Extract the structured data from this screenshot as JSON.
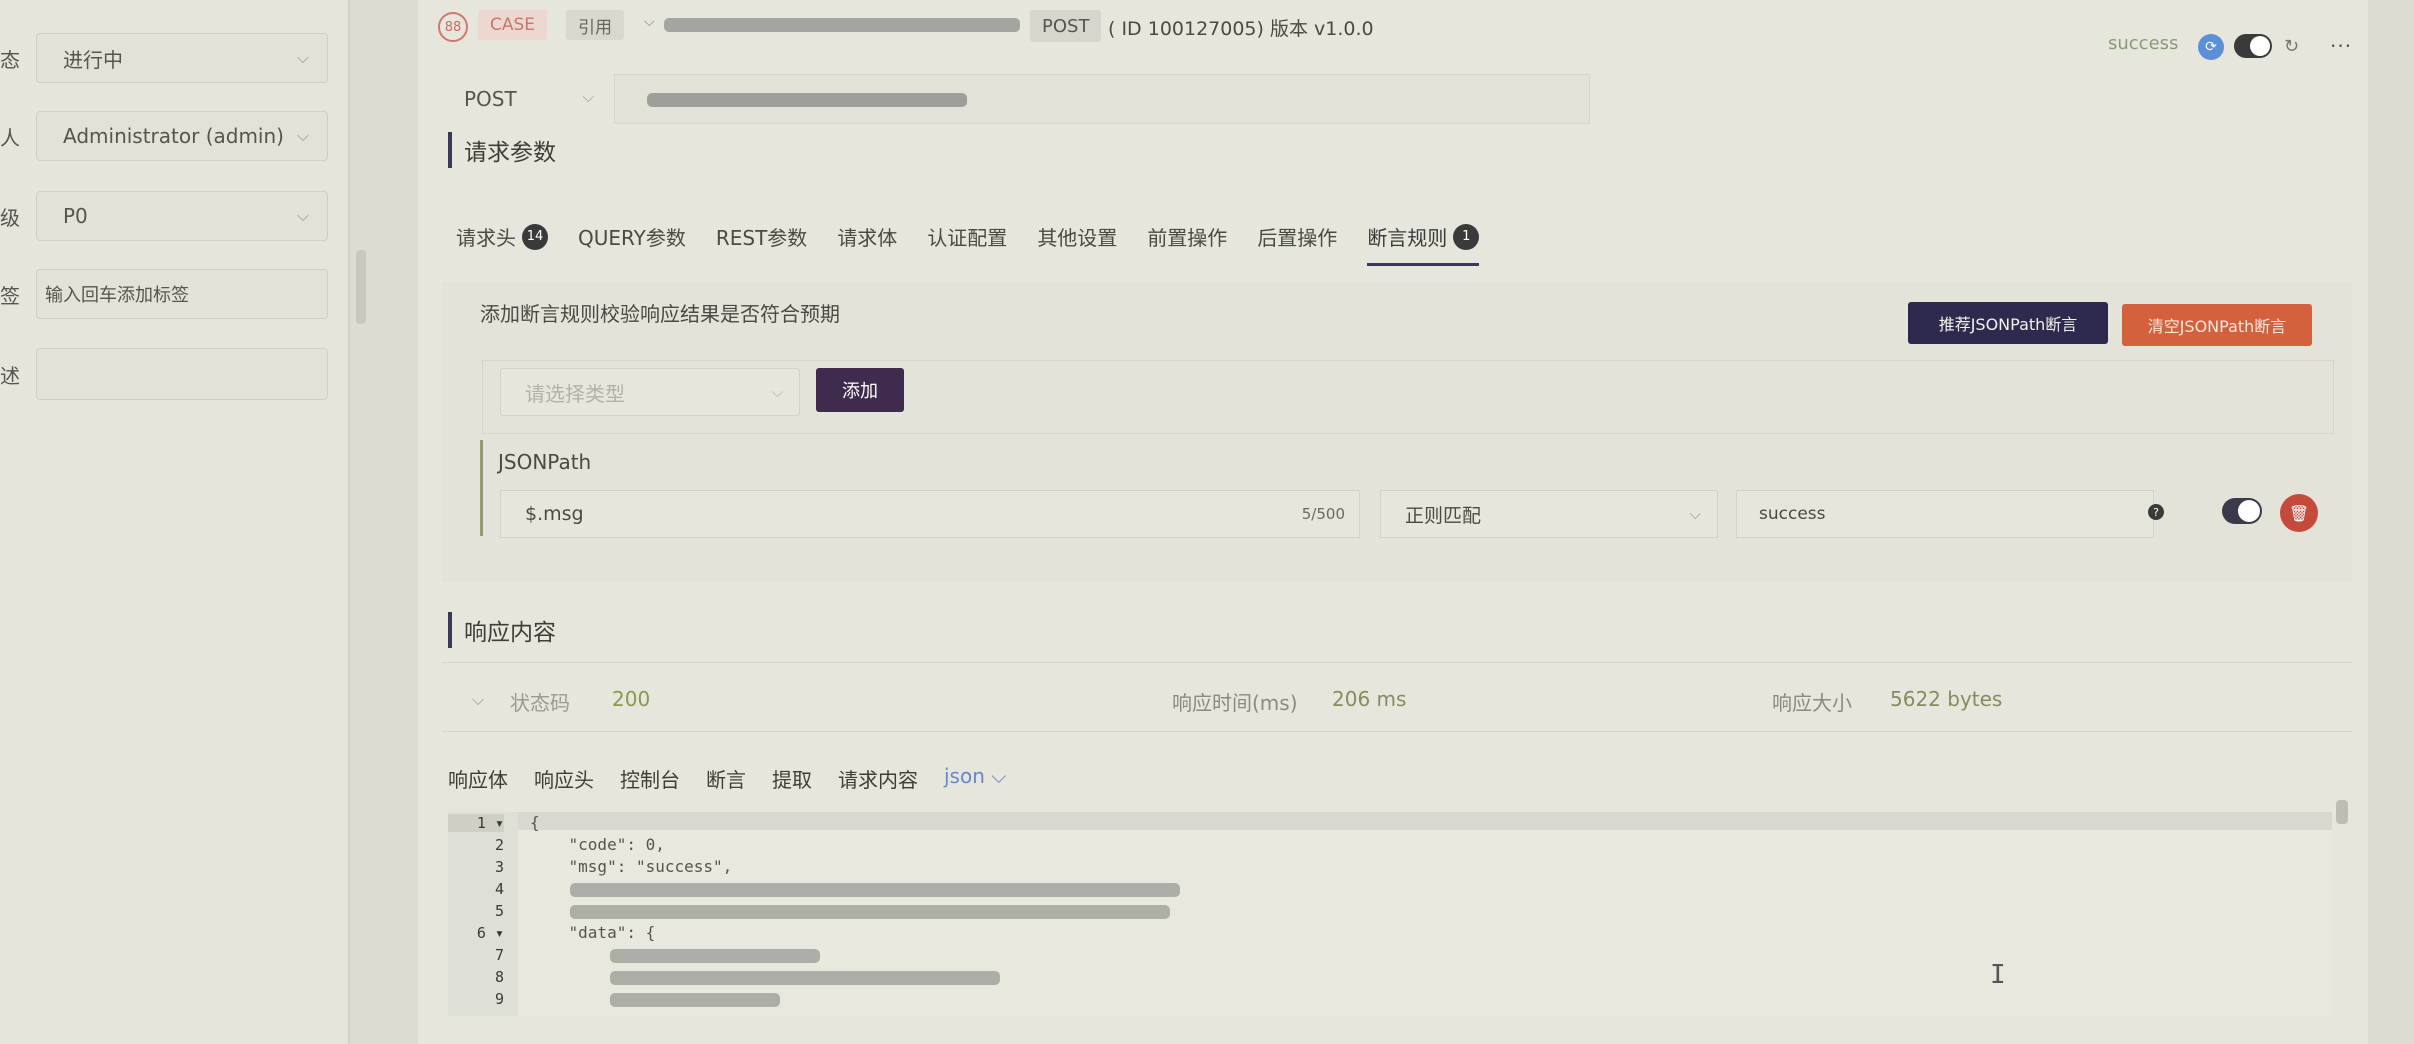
{
  "left_form": {
    "status": {
      "label": "态",
      "value": "进行中"
    },
    "owner": {
      "label": "人",
      "value": "Administrator (admin)"
    },
    "level": {
      "label": "级",
      "value": "P0"
    },
    "tags": {
      "label": "签",
      "placeholder": "输入回车添加标签"
    },
    "desc": {
      "label": "述",
      "value": ""
    }
  },
  "header": {
    "badge_number": "88",
    "case_tag": "CASE",
    "ref_tag": "引用",
    "method_tag": "POST",
    "id_version": "( ID 100127005) 版本 v1.0.0",
    "status_text": "success",
    "more": "···"
  },
  "url_bar": {
    "method": "POST"
  },
  "request": {
    "section_title": "请求参数",
    "tabs": [
      {
        "label": "请求头",
        "count": "14"
      },
      {
        "label": "QUERY参数",
        "count": ""
      },
      {
        "label": "REST参数",
        "count": ""
      },
      {
        "label": "请求体",
        "count": ""
      },
      {
        "label": "认证配置",
        "count": ""
      },
      {
        "label": "其他设置",
        "count": ""
      },
      {
        "label": "前置操作",
        "count": ""
      },
      {
        "label": "后置操作",
        "count": ""
      },
      {
        "label": "断言规则",
        "count": "1"
      }
    ],
    "assert_hint": "添加断言规则校验响应结果是否符合预期",
    "recommend_btn": "推荐JSONPath断言",
    "clear_btn": "清空JSONPath断言",
    "type_placeholder": "请选择类型",
    "add_btn": "添加",
    "rule": {
      "label": "JSONPath",
      "path": "$.msg",
      "count": "5/500",
      "condition": "正则匹配",
      "expected": "success",
      "help": "?"
    }
  },
  "response": {
    "section_title": "响应内容",
    "status_label": "状态码",
    "status_value": "200",
    "time_label": "响应时间(ms)",
    "time_value": "206 ms",
    "size_label": "响应大小",
    "size_value": "5622 bytes",
    "tabs": [
      "响应体",
      "响应头",
      "控制台",
      "断言",
      "提取",
      "请求内容"
    ],
    "format": "json",
    "lines": [
      {
        "n": "1 ▾",
        "text": "{"
      },
      {
        "n": "2",
        "text": "    \"code\": 0,"
      },
      {
        "n": "3",
        "text": "    \"msg\": \"success\","
      },
      {
        "n": "4",
        "text": ""
      },
      {
        "n": "5",
        "text": ""
      },
      {
        "n": "6 ▾",
        "text": "    \"data\": {"
      },
      {
        "n": "7",
        "text": ""
      },
      {
        "n": "8",
        "text": ""
      },
      {
        "n": "9",
        "text": ""
      }
    ]
  },
  "colors": {
    "accent": "#2e2a4e",
    "danger": "#d4613e",
    "success_text": "#8a9a4a"
  }
}
